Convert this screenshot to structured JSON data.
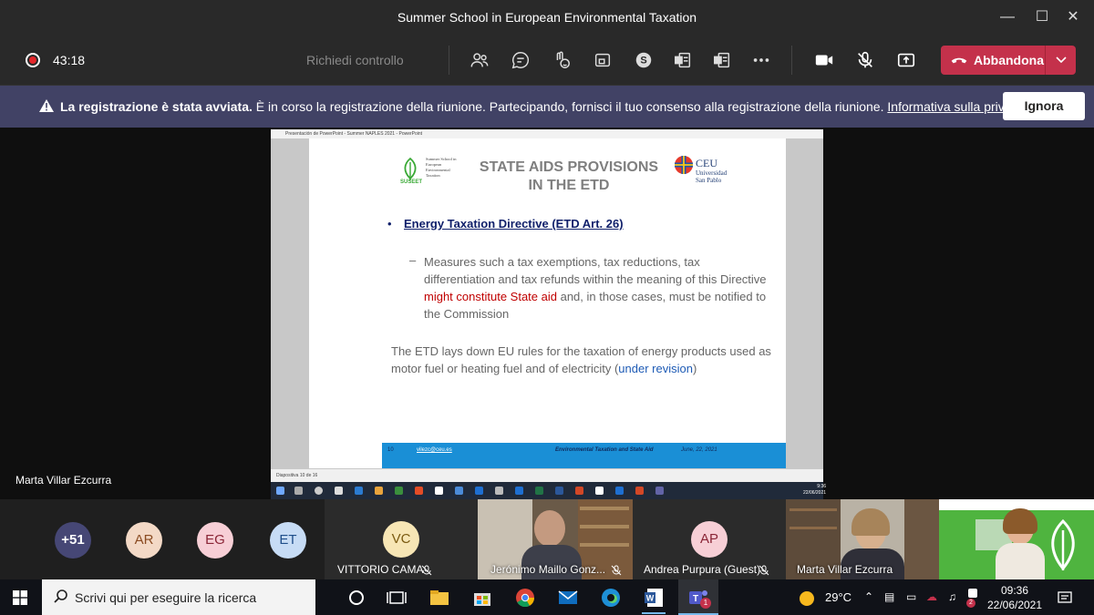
{
  "window": {
    "title": "Summer School in European Environmental Taxation"
  },
  "toolbar": {
    "timer": "43:18",
    "request_control": "Richiedi controllo",
    "leave_label": "Abbandona",
    "colors": {
      "leave": "#c4314b",
      "record": "#e3262a"
    }
  },
  "banner": {
    "bold_text": "La registrazione è stata avviata.",
    "text": " È in corso la registrazione della riunione. Partecipando, fornisci il tuo consenso alla registrazione della riunione.",
    "link": "Informativa sulla privacy",
    "ignore_label": "Ignora"
  },
  "stage": {
    "presenter": "Marta Villar Ezcurra",
    "ppt_window_title": "Presentación de PowerPoint  -  Summer NAPLES 2021  -  PowerPoint",
    "ppt_status": "Diapositiva 10 de 16",
    "slide": {
      "title_line1": "STATE AIDS PROVISIONS",
      "title_line2": "IN THE ETD",
      "logo_left_name": "SUSEET",
      "logo_left_text": "Summer School in European Environmental Taxation",
      "logo_right_name": "CEU",
      "logo_right_sub1": "Universidad",
      "logo_right_sub2": "San Pablo",
      "bullet": "Energy Taxation Directive (ETD Art. 26)",
      "sub_pre": "Measures such a tax exemptions, tax reductions, tax differentiation and tax refunds within the meaning of this Directive ",
      "sub_red": "might constitute State aid",
      "sub_post": " and, in those cases, must be notified to the Commission",
      "note_pre": "The ETD lays down EU rules for the taxation of energy products used as motor fuel or heating fuel and of electricity (",
      "note_blue": "under revision",
      "note_post": ")",
      "footer_page": "10",
      "footer_email": "vilezc@ceu.es",
      "footer_title": "Environmental Taxation and State Aid",
      "footer_date": "June, 22, 2021"
    },
    "inner_clock": {
      "time": "9:36",
      "date": "22/06/2021"
    }
  },
  "participants": {
    "overflow": "+51",
    "avatars": [
      {
        "initials": "AR",
        "bg": "#f3d9c6",
        "fg": "#8a4b21"
      },
      {
        "initials": "EG",
        "bg": "#f7cfd6",
        "fg": "#8a2536"
      },
      {
        "initials": "ET",
        "bg": "#c7dcf5",
        "fg": "#1f4e8a"
      }
    ],
    "tiles": [
      {
        "initials": "VC",
        "name": "VITTORIO CAMA",
        "bg": "#f7e6b5",
        "fg": "#7a5a10"
      },
      {
        "name": "Jerónimo Maillo Gonz..."
      },
      {
        "initials": "AP",
        "name": "Andrea Purpura (Guest)",
        "bg": "#f7cfd6",
        "fg": "#8a2536"
      },
      {
        "name": "Marta Villar Ezcurra"
      }
    ]
  },
  "taskbar": {
    "search_placeholder": "Scrivi qui per eseguire la ricerca",
    "weather": "29°C",
    "time": "09:36",
    "date": "22/06/2021",
    "teams_badge": "1",
    "tray_badge": "2"
  }
}
